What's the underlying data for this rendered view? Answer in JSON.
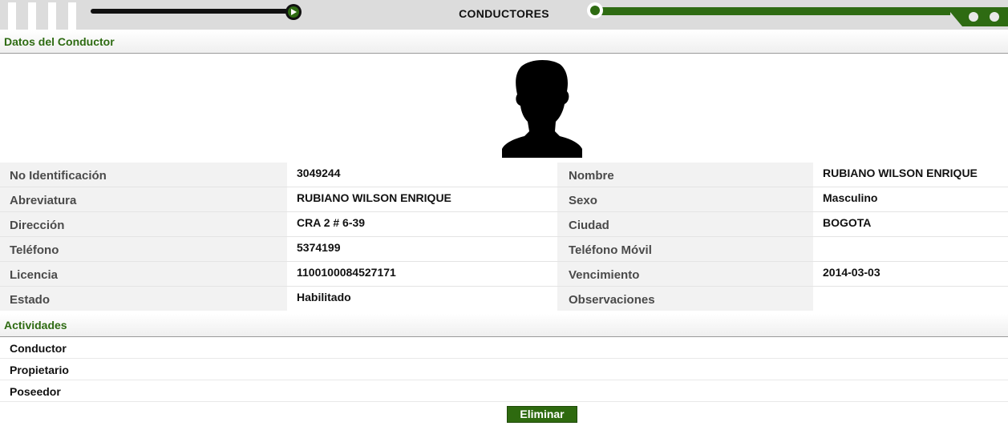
{
  "header": {
    "title": "CONDUCTORES"
  },
  "sections": {
    "driver_data": "Datos del Conductor",
    "activities": "Actividades"
  },
  "details": {
    "rows": [
      {
        "label_left": "No Identificación",
        "value_left": "3049244",
        "label_right": "Nombre",
        "value_right": "RUBIANO WILSON ENRIQUE"
      },
      {
        "label_left": "Abreviatura",
        "value_left": "RUBIANO WILSON ENRIQUE",
        "label_right": "Sexo",
        "value_right": "Masculino"
      },
      {
        "label_left": "Dirección",
        "value_left": "CRA 2 # 6-39",
        "label_right": "Ciudad",
        "value_right": "BOGOTA"
      },
      {
        "label_left": "Teléfono",
        "value_left": "5374199",
        "label_right": "Teléfono Móvil",
        "value_right": ""
      },
      {
        "label_left": "Licencia",
        "value_left": "1100100084527171",
        "label_right": "Vencimiento",
        "value_right": "2014-03-03"
      },
      {
        "label_left": "Estado",
        "value_left": "Habilitado",
        "label_right": "Observaciones",
        "value_right": ""
      }
    ]
  },
  "activities": [
    "Conductor",
    "Propietario",
    "Poseedor"
  ],
  "actions": {
    "delete_label": "Eliminar"
  },
  "colors": {
    "accent_green": "#2e6b12",
    "button_green": "#2e6a0f",
    "header_gray": "#dcdcdc"
  },
  "icons": {
    "photo": "person-silhouette-icon",
    "play": "play-icon"
  }
}
